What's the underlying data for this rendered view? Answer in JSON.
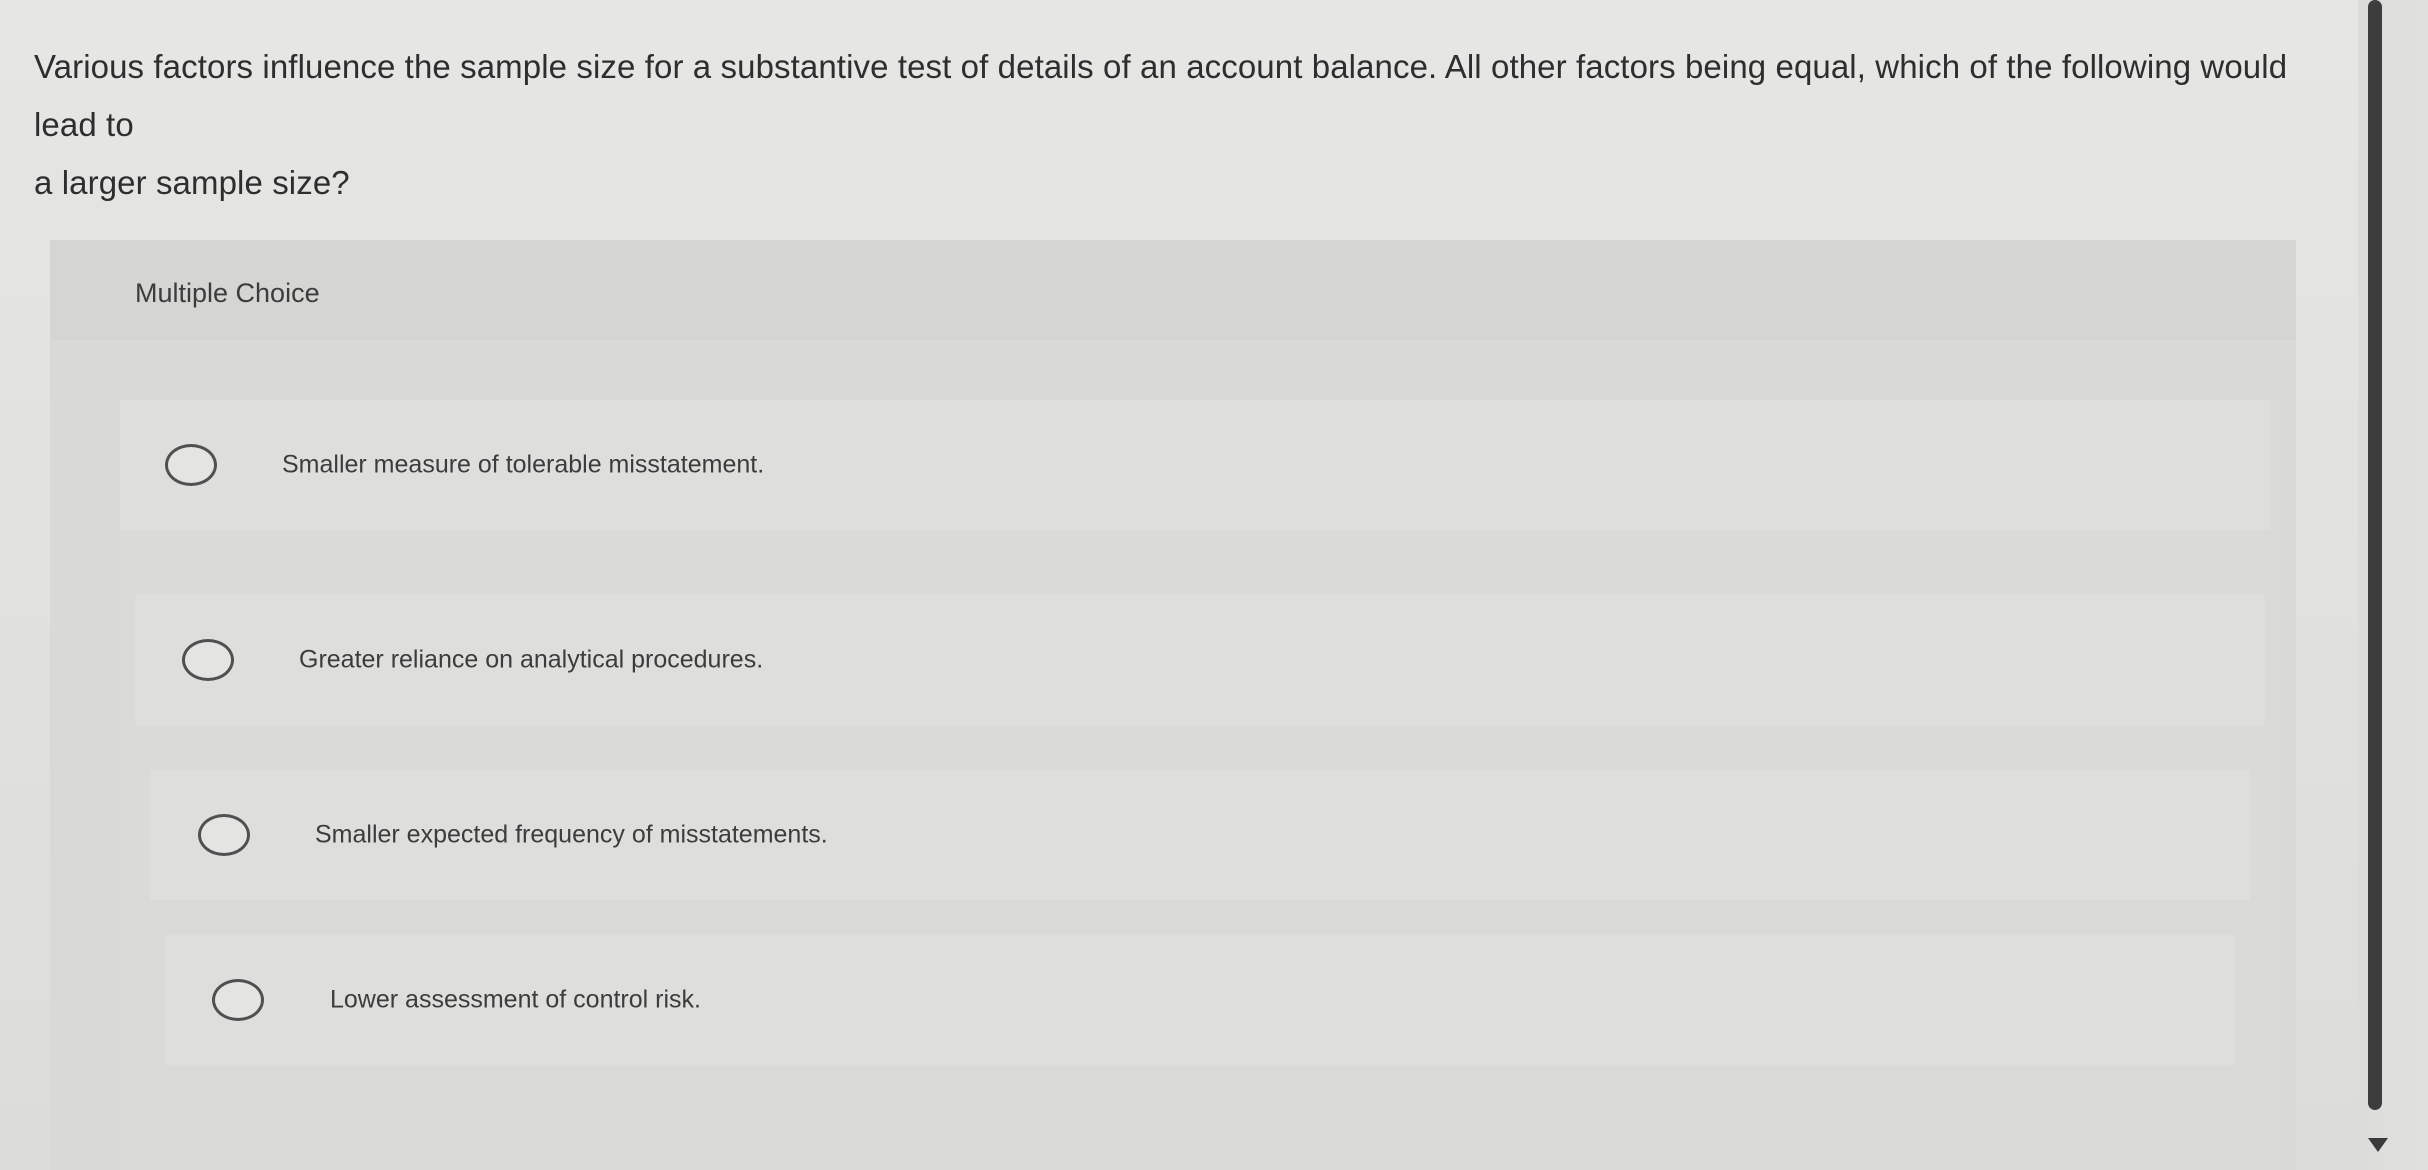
{
  "question": {
    "line1": "Various factors influence the sample size for a substantive test of details of an account balance. All other factors being equal, which of the following would lead to",
    "line2": "a larger sample size?"
  },
  "multiple_choice": {
    "header": "Multiple Choice",
    "options": [
      {
        "label": "Smaller measure of tolerable misstatement."
      },
      {
        "label": "Greater reliance on analytical procedures."
      },
      {
        "label": "Smaller expected frequency of misstatements."
      },
      {
        "label": "Lower assessment of control risk."
      }
    ]
  },
  "scrollbar": {
    "down_arrow_icon": "triangle-down"
  }
}
